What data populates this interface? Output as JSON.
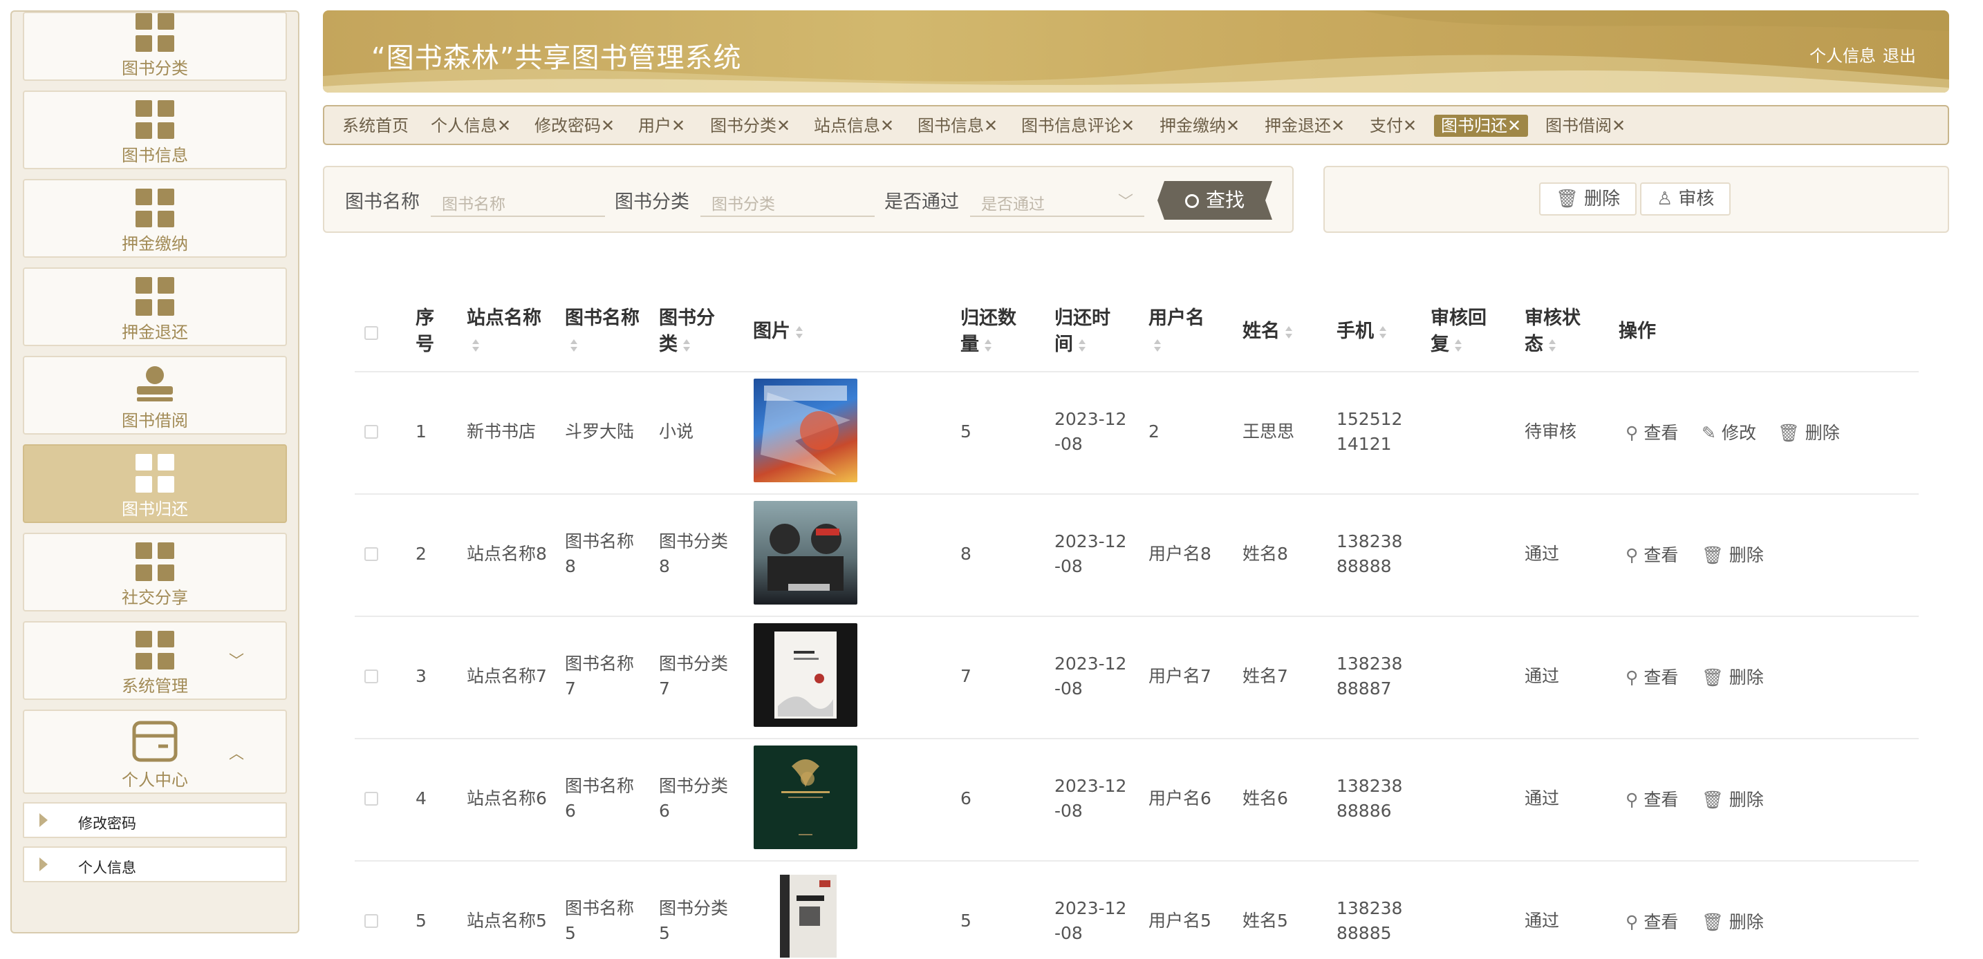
{
  "sidebar": {
    "items": [
      {
        "label": "图书分类",
        "icon": "grid-icon"
      },
      {
        "label": "图书信息",
        "icon": "grid-icon"
      },
      {
        "label": "押金缴纳",
        "icon": "grid-icon"
      },
      {
        "label": "押金退还",
        "icon": "grid-icon"
      },
      {
        "label": "图书借阅",
        "icon": "user-stamp-icon"
      },
      {
        "label": "图书归还",
        "icon": "grid-icon",
        "active": true
      },
      {
        "label": "社交分享",
        "icon": "grid-icon"
      },
      {
        "label": "系统管理",
        "icon": "grid-icon",
        "expand": "chevron-down"
      },
      {
        "label": "个人中心",
        "icon": "card-icon",
        "expand": "chevron-up"
      }
    ],
    "sub_items": [
      {
        "label": "修改密码"
      },
      {
        "label": "个人信息"
      }
    ]
  },
  "header": {
    "title": "“图书森林”共享图书管理系统",
    "profile_link": "个人信息",
    "logout_link": "退出"
  },
  "tabs": [
    {
      "label": "系统首页"
    },
    {
      "label": "个人信息✕"
    },
    {
      "label": "修改密码✕"
    },
    {
      "label": "用户✕"
    },
    {
      "label": "图书分类✕"
    },
    {
      "label": "站点信息✕"
    },
    {
      "label": "图书信息✕"
    },
    {
      "label": "图书信息评论✕"
    },
    {
      "label": "押金缴纳✕"
    },
    {
      "label": "押金退还✕"
    },
    {
      "label": "支付✕"
    },
    {
      "label": "图书归还✕",
      "active": true
    },
    {
      "label": "图书借阅✕"
    }
  ],
  "search": {
    "book_name_label": "图书名称",
    "book_name_placeholder": "图书名称",
    "category_label": "图书分类",
    "category_placeholder": "图书分类",
    "approved_label": "是否通过",
    "approved_placeholder": "是否通过",
    "search_button": "查找"
  },
  "actions": {
    "delete_button": "删除",
    "review_button": "审核"
  },
  "table": {
    "headers": [
      "序号",
      "站点名称",
      "图书名称",
      "图书分类",
      "图片",
      "归还数量",
      "归还时间",
      "用户名",
      "姓名",
      "手机",
      "审核回复",
      "审核状态",
      "操作"
    ],
    "rows": [
      {
        "index": "1",
        "site": "新书书店",
        "book": "斗罗大陆",
        "category": "小说",
        "qty": "5",
        "time": "2023-12-08",
        "username": "2",
        "name": "王思思",
        "phone": "15251214121",
        "reply": "",
        "status": "待审核",
        "ops": [
          "查看",
          "修改",
          "删除"
        ]
      },
      {
        "index": "2",
        "site": "站点名称8",
        "book": "图书名称8",
        "category": "图书分类8",
        "qty": "8",
        "time": "2023-12-08",
        "username": "用户名8",
        "name": "姓名8",
        "phone": "13823888888",
        "reply": "",
        "status": "通过",
        "ops": [
          "查看",
          "删除"
        ]
      },
      {
        "index": "3",
        "site": "站点名称7",
        "book": "图书名称7",
        "category": "图书分类7",
        "qty": "7",
        "time": "2023-12-08",
        "username": "用户名7",
        "name": "姓名7",
        "phone": "13823888887",
        "reply": "",
        "status": "通过",
        "ops": [
          "查看",
          "删除"
        ]
      },
      {
        "index": "4",
        "site": "站点名称6",
        "book": "图书名称6",
        "category": "图书分类6",
        "qty": "6",
        "time": "2023-12-08",
        "username": "用户名6",
        "name": "姓名6",
        "phone": "13823888886",
        "reply": "",
        "status": "通过",
        "ops": [
          "查看",
          "删除"
        ]
      },
      {
        "index": "5",
        "site": "站点名称5",
        "book": "图书名称5",
        "category": "图书分类5",
        "qty": "5",
        "time": "2023-12-08",
        "username": "用户名5",
        "name": "姓名5",
        "phone": "13823888885",
        "reply": "",
        "status": "通过",
        "ops": [
          "查看",
          "删除"
        ]
      }
    ]
  },
  "colors": {
    "accent": "#a28b56",
    "header_gold": "#c9aa5f",
    "active_menu": "#dcc99a",
    "active_tab": "#9f8747",
    "search_button": "#6b6559"
  }
}
